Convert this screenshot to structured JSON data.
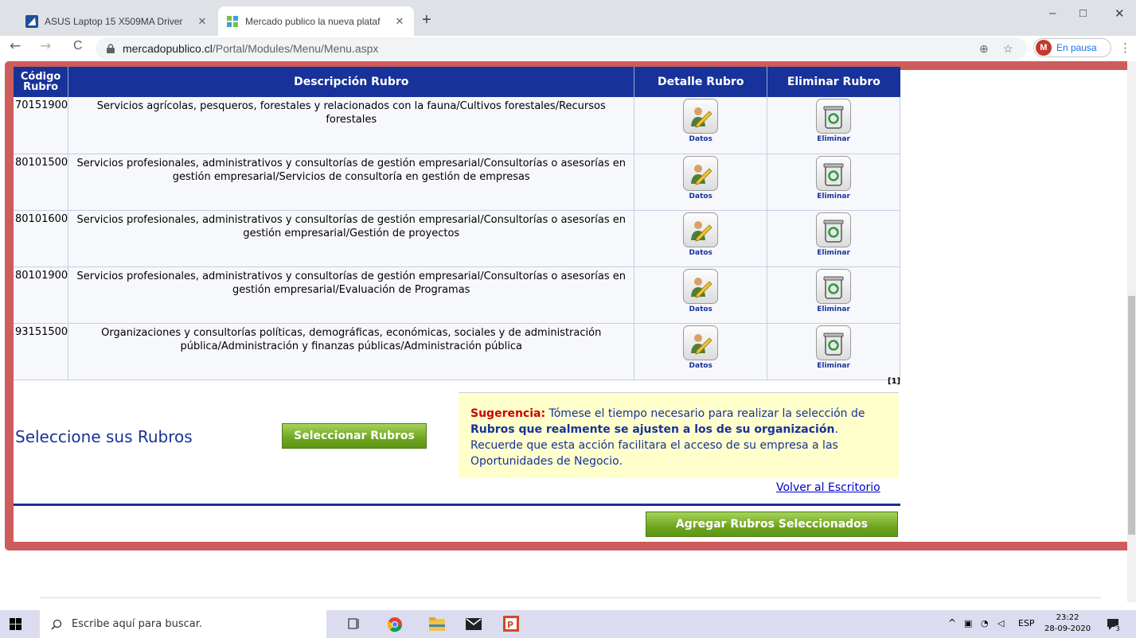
{
  "browser": {
    "tabs": [
      {
        "title": "ASUS Laptop 15 X509MA Driver",
        "active": false
      },
      {
        "title": "Mercado publico la nueva plataf",
        "active": true
      }
    ],
    "new_tab": "+",
    "window": {
      "minimize": "–",
      "restore": "□",
      "close": "✕"
    },
    "nav": {
      "back": "←",
      "forward": "→",
      "reload": "C"
    },
    "url_host": "mercadopublico.cl",
    "url_path": "/Portal/Modules/Menu/Menu.aspx",
    "zoom_icon": "⊕",
    "star_icon": "☆",
    "profile_initial": "M",
    "profile_status": "En pausa",
    "menu_icon": "⋮"
  },
  "table": {
    "headers": {
      "code_line1": "Código",
      "code_line2": "Rubro",
      "description": "Descripción Rubro",
      "detail": "Detalle Rubro",
      "delete": "Eliminar Rubro"
    },
    "rows": [
      {
        "code": "70151900",
        "description": "Servicios agrícolas, pesqueros, forestales y relacionados con la fauna/Cultivos forestales/Recursos forestales"
      },
      {
        "code": "80101500",
        "description": "Servicios profesionales, administrativos y consultorías de gestión empresarial/Consultorías o asesorías en gestión empresarial/Servicios de consultoría en gestión de empresas"
      },
      {
        "code": "80101600",
        "description": "Servicios profesionales, administrativos y consultorías de gestión empresarial/Consultorías o asesorías en gestión empresarial/Gestión de proyectos"
      },
      {
        "code": "80101900",
        "description": "Servicios profesionales, administrativos y consultorías de gestión empresarial/Consultorías o asesorías en gestión empresarial/Evaluación de Programas"
      },
      {
        "code": "93151500",
        "description": "Organizaciones y consultorías políticas, demográficas, económicas, sociales y de administración pública/Administración y finanzas públicas/Administración pública"
      }
    ],
    "detail_label": "Datos",
    "delete_label": "Eliminar",
    "pager": "[1]"
  },
  "select_title": "Seleccione sus Rubros",
  "select_button": "Seleccionar Rubros",
  "hint": {
    "lead": "Sugerencia:",
    "text1": " Tómese el tiempo necesario para realizar la selección de ",
    "bold": "Rubros que realmente se ajusten a los de su organización",
    "text2": ". Recuerde que esta acción facilitara el acceso de su empresa a las Oportunidades de Negocio."
  },
  "back_link": "Volver al Escritorio",
  "add_button": "Agregar Rubros Seleccionados",
  "taskbar": {
    "search_placeholder": "Escribe aquí para buscar.",
    "lang": "ESP",
    "time": "23:22",
    "date": "28-09-2020",
    "notification_count": "3"
  },
  "colors": {
    "header_blue": "#17329a",
    "highlight_border": "#cd5c5c",
    "button_green": "#6ea51e",
    "hint_bg": "#ffffcc",
    "hint_lead": "#cc0000"
  }
}
